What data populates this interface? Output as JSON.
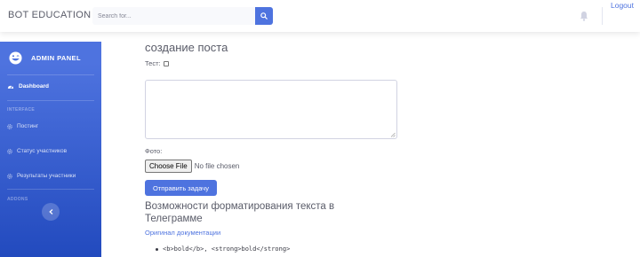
{
  "topbar": {
    "brand": "BOT EDUCATION",
    "search_placeholder": "Search for...",
    "logout": "Logout"
  },
  "sidebar": {
    "brand": "ADMIN PANEL",
    "dashboard": "Dashboard",
    "heading_interface": "INTERFACE",
    "items": [
      {
        "label": "Постинг"
      },
      {
        "label": "Статус участников"
      },
      {
        "label": "Результаты участники"
      }
    ],
    "heading_addons": "ADDONS"
  },
  "main": {
    "title": "создание поста",
    "checkbox_label": "Тест:",
    "photo_label": "Фото:",
    "file_button": "Choose File",
    "file_status": "No file chosen",
    "submit": "Отправить задачу",
    "section_title": "Возможности форматирования текста в Телеграмме",
    "doc_link": "Оригинал документации",
    "bullets": [
      "<b>bold</b>, <strong>bold</strong>"
    ]
  },
  "colors": {
    "primary": "#4e73df",
    "sidebar_gradient_end": "#224abe",
    "text": "#5a5c69"
  }
}
